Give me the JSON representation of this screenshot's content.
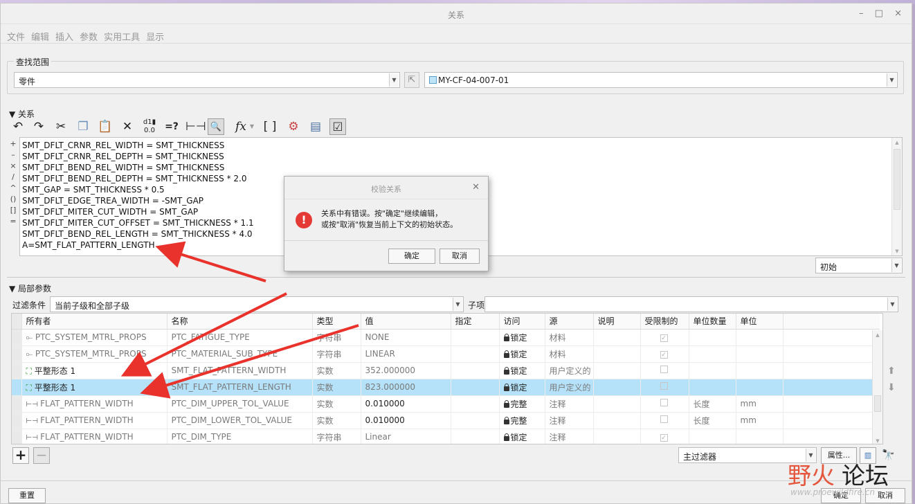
{
  "window": {
    "title": "关系",
    "controls": "– □ ×"
  },
  "menu": [
    "文件",
    "编辑",
    "插入",
    "参数",
    "实用工具",
    "显示"
  ],
  "search_scope": {
    "legend": "查找范围",
    "type_value": "零件",
    "model_value": "MY-CF-04-007-01"
  },
  "relations": {
    "header": "关系",
    "gutter": [
      "+",
      "–",
      "×",
      "/",
      "^",
      "()",
      "[]",
      "="
    ],
    "lines": [
      "SMT_DFLT_CRNR_REL_WIDTH = SMT_THICKNESS",
      "SMT_DFLT_CRNR_REL_DEPTH = SMT_THICKNESS",
      "SMT_DFLT_BEND_REL_WIDTH = SMT_THICKNESS",
      "SMT_DFLT_BEND_REL_DEPTH = SMT_THICKNESS * 2.0",
      "SMT_GAP = SMT_THICKNESS * 0.5",
      "SMT_DFLT_EDGE_TREA_WIDTH = -SMT_GAP",
      "SMT_DFLT_MITER_CUT_WIDTH = SMT_GAP",
      "SMT_DFLT_MITER_CUT_OFFSET = SMT_THICKNESS * 1.1",
      "SMT_DFLT_BEND_REL_LENGTH = SMT_THICKNESS * 4.0",
      "A=SMT_FLAT_PATTERN_LENGTH"
    ],
    "init_select": "初始",
    "toolbar_icons": [
      "undo-icon",
      "redo-icon",
      "cut-icon",
      "copy-icon",
      "paste-icon",
      "delete-icon",
      "switch-dims-icon",
      "evaluate-icon",
      "measure-icon",
      "show-values-icon",
      "insert-function-icon",
      "insert-parameter-icon",
      "insert-relation-icon",
      "sort-icon",
      "verify-icon"
    ]
  },
  "dialog": {
    "title": "校验关系",
    "line1": "关系中有错误。按\"确定\"继续编辑，",
    "line2": "或按\"取消\"恢复当前上下文的初始状态。",
    "ok": "确定",
    "cancel": "取消"
  },
  "local_params": {
    "header": "局部参数",
    "filter_label": "过滤条件",
    "filter_value": "当前子级和全部子级",
    "child_label": "子项",
    "columns": [
      "所有者",
      "名称",
      "类型",
      "值",
      "指定",
      "访问",
      "源",
      "说明",
      "受限制的",
      "单位数量",
      "单位"
    ],
    "rows": [
      {
        "owner": "PTC_SYSTEM_MTRL_PROPS",
        "name": "PTC_FATIGUE_TYPE",
        "type": "字符串",
        "value": "NONE",
        "access": "锁定",
        "source": "材料",
        "restricted": "✓",
        "qty": "",
        "unit": ""
      },
      {
        "owner": "PTC_SYSTEM_MTRL_PROPS",
        "name": "PTC_MATERIAL_SUB_TYPE",
        "type": "字符串",
        "value": "LINEAR",
        "access": "锁定",
        "source": "材料",
        "restricted": "✓",
        "qty": "",
        "unit": ""
      },
      {
        "owner": "平整形态 1",
        "name": "SMT_FLAT_PATTERN_WIDTH",
        "type": "实数",
        "value": "352.000000",
        "access": "锁定",
        "source": "用户定义的",
        "restricted": "",
        "qty": "",
        "unit": ""
      },
      {
        "owner": "平整形态 1",
        "name": "SMT_FLAT_PATTERN_LENGTH",
        "type": "实数",
        "value": "823.000000",
        "access": "锁定",
        "source": "用户定义的",
        "restricted": "",
        "qty": "",
        "unit": ""
      },
      {
        "owner": "FLAT_PATTERN_WIDTH",
        "name": "PTC_DIM_UPPER_TOL_VALUE",
        "type": "实数",
        "value": "0.010000",
        "access": "完整",
        "source": "注释",
        "restricted": "",
        "qty": "长度",
        "unit": "mm"
      },
      {
        "owner": "FLAT_PATTERN_WIDTH",
        "name": "PTC_DIM_LOWER_TOL_VALUE",
        "type": "实数",
        "value": "0.010000",
        "access": "完整",
        "source": "注释",
        "restricted": "",
        "qty": "长度",
        "unit": "mm"
      },
      {
        "owner": "FLAT_PATTERN_WIDTH",
        "name": "PTC_DIM_TYPE",
        "type": "字符串",
        "value": "Linear",
        "access": "锁定",
        "source": "注释",
        "restricted": "✓",
        "qty": "",
        "unit": ""
      }
    ],
    "main_filter": "主过滤器",
    "properties_button": "属性...",
    "add": "+",
    "remove": "−"
  },
  "footer": {
    "reset": "重置",
    "ok": "确定",
    "cancel": "取消"
  },
  "watermark": {
    "brand_a": "野火",
    "brand_b": "论坛",
    "url": "www.proewildfire.cn"
  },
  "colors": {
    "selected_row": "#b5e2f9",
    "error_icon": "#e53935",
    "arrow": "#e8322b"
  }
}
